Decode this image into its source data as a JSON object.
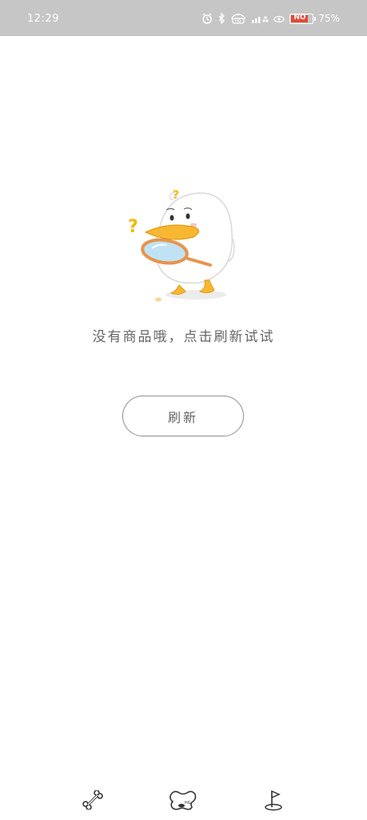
{
  "status_bar": {
    "time": "12:29",
    "battery_percent": "75%",
    "battery_label": "NO",
    "icons": [
      "alarm-icon",
      "bluetooth-icon",
      "hd-icon",
      "signal-icon",
      "eye-icon",
      "battery-icon"
    ]
  },
  "empty_state": {
    "illustration": "duck-magnifier-illustration",
    "message": "没有商品哦，点击刷新试试"
  },
  "refresh_button": {
    "label": "刷新"
  },
  "bottom_nav": {
    "items": [
      {
        "icon": "bone-icon"
      },
      {
        "icon": "home-icon"
      },
      {
        "icon": "flag-icon"
      }
    ]
  },
  "colors": {
    "status_bar_bg": "#c6c6c6",
    "text_gray": "#666666",
    "duck_beak": "#f7b731",
    "question_mark": "#f5b800",
    "battery_red": "#e24a3b"
  }
}
